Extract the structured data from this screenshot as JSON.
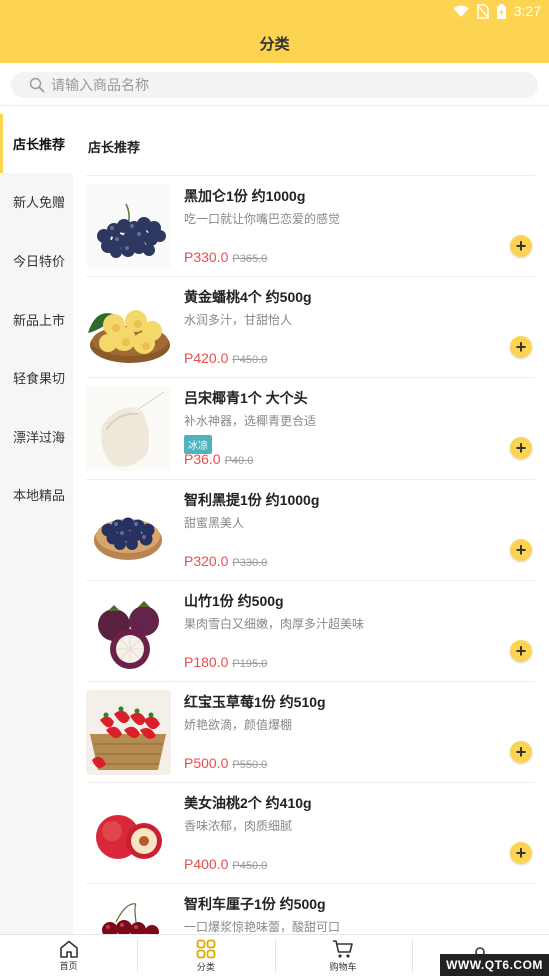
{
  "status_bar": {
    "time": "3:27"
  },
  "header": {
    "title": "分类"
  },
  "search": {
    "placeholder": "请输入商品名称"
  },
  "sidebar": {
    "items": [
      {
        "label": "店长推荐",
        "active": true
      },
      {
        "label": "新人免赠",
        "active": false
      },
      {
        "label": "今日特价",
        "active": false
      },
      {
        "label": "新品上市",
        "active": false
      },
      {
        "label": "轻食果切",
        "active": false
      },
      {
        "label": "漂洋过海",
        "active": false
      },
      {
        "label": "本地精品",
        "active": false
      }
    ]
  },
  "section": {
    "title": "店长推荐"
  },
  "products": [
    {
      "name": "黑加仑1份 约1000g",
      "desc": "吃一口就让你嘴巴恋爱的感觉",
      "price": "P330.0",
      "old_price": "P365.0",
      "tag": ""
    },
    {
      "name": "黄金蟠桃4个 约500g",
      "desc": "水润多汁，甘甜怡人",
      "price": "P420.0",
      "old_price": "P450.0",
      "tag": ""
    },
    {
      "name": "吕宋椰青1个 大个头",
      "desc": "补水神器，选椰青更合适",
      "price": "P36.0",
      "old_price": "P40.0",
      "tag": "冰凉"
    },
    {
      "name": "智利黑提1份 约1000g",
      "desc": "甜蜜黑美人",
      "price": "P320.0",
      "old_price": "P330.0",
      "tag": ""
    },
    {
      "name": "山竹1份 约500g",
      "desc": "果肉雪白又细嫩，肉厚多汁超美味",
      "price": "P180.0",
      "old_price": "P195.0",
      "tag": ""
    },
    {
      "name": "红宝玉草莓1份 约510g",
      "desc": "娇艳欲滴，颜值爆棚",
      "price": "P500.0",
      "old_price": "P550.0",
      "tag": ""
    },
    {
      "name": "美女油桃2个 约410g",
      "desc": "香味浓郁，肉质细腻",
      "price": "P400.0",
      "old_price": "P450.0",
      "tag": ""
    },
    {
      "name": "智利车厘子1份 约500g",
      "desc": "一口爆浆惊艳味蕾，酸甜可口",
      "price": "",
      "old_price": "",
      "tag": ""
    }
  ],
  "add_symbol": "+",
  "tabbar": {
    "tabs": [
      {
        "label": "首页",
        "icon": "home-icon"
      },
      {
        "label": "分类",
        "icon": "category-grid-icon"
      },
      {
        "label": "购物车",
        "icon": "cart-icon"
      },
      {
        "label": "",
        "icon": "user-icon"
      }
    ]
  },
  "watermark": "WWW.QT6.COM",
  "colors": {
    "brand": "#fcd452",
    "price": "#e94d4d",
    "tag": "#4fb3bf"
  }
}
